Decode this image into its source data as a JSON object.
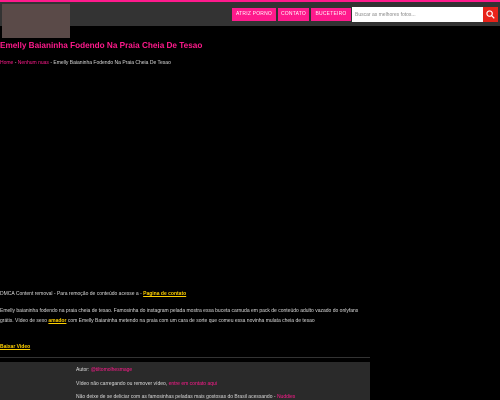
{
  "nav": {
    "items": [
      {
        "label": "ATRIZ PORNO"
      },
      {
        "label": "CONTATO"
      },
      {
        "label": "BUCETEIRO"
      }
    ]
  },
  "search": {
    "placeholder": "Buscar as melhores fotos..."
  },
  "page": {
    "title": "Emelly Baianinha Fodendo Na Praia Cheia De Tesao"
  },
  "breadcrumb": {
    "home": "Home",
    "sep1": " - ",
    "category": "Nenhum nuas",
    "sep2": " - ",
    "current": "Emelly Baianinha Fodendo Na Praia Cheia De Tesao"
  },
  "dmca": {
    "text": "DMCA Content removal - Para remoção de conteúdo acesse a - ",
    "link": "Pagina de contato"
  },
  "description": {
    "part1": "Emelly baianinha fodendo na praia cheia de tesao. Famosinha do instagram pelada mostra essa buceta carnuda em pack de conteúdo adulto vazado do onlyfans grátis. Vídeo de sexo ",
    "link": "amador",
    "part2": " com Emelly Baianinha metendo na praia com um cara de sorte que comeu essa novinha mulata cheia de tesao"
  },
  "download": {
    "label": "Baixar Video"
  },
  "comment": {
    "author_label": "Autor: ",
    "author": "@tiltomolhesmage",
    "notice_text": "Vídeo não carregando ou remover vídeo, ",
    "notice_link": "entre em contato aqui",
    "more_text": "Não deixe de se deliciar com as famosinhas peladas mais gostosas do Brasil acessando - ",
    "more_link": "Nuddies"
  },
  "colors": {
    "accent": "#ff1a8c",
    "link_highlight": "#ffd000",
    "search_button": "#e8231a"
  },
  "icons": {
    "search": "search-icon"
  }
}
